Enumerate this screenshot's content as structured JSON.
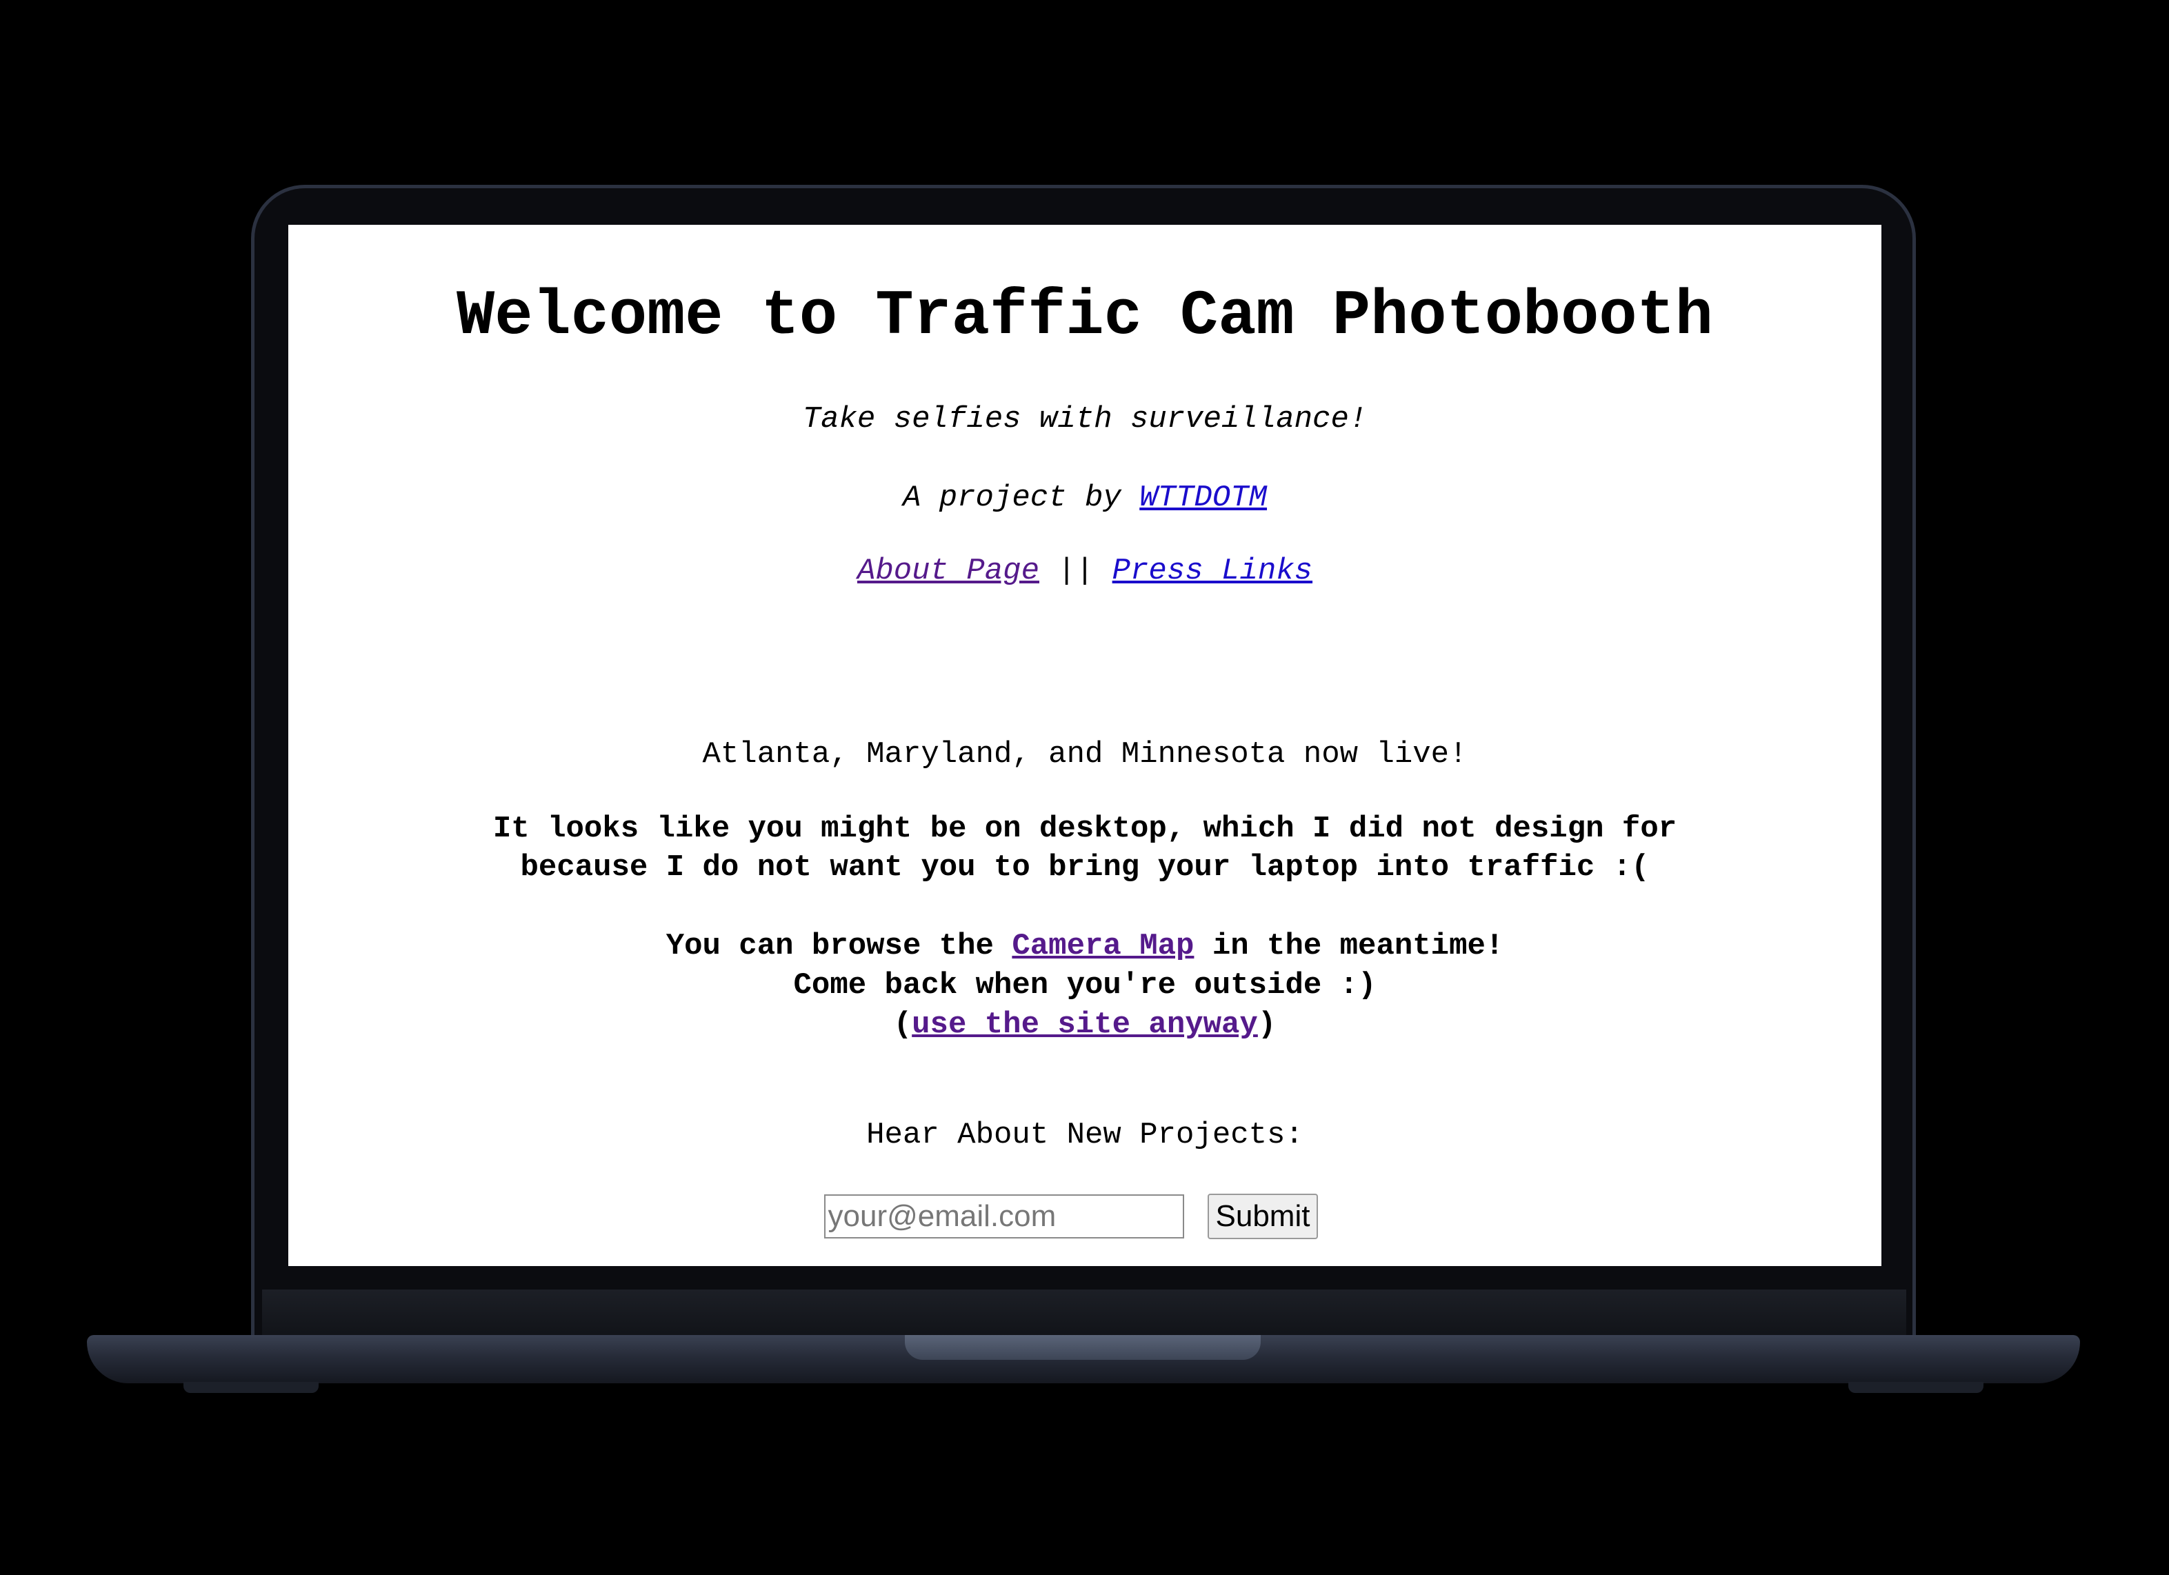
{
  "page": {
    "title": "Welcome to Traffic Cam Photobooth",
    "tagline": "Take selfies with surveillance!",
    "byline_prefix": "A project by ",
    "byline_link": "WTTDOTM",
    "nav": {
      "about_label": "About Page",
      "separator": " || ",
      "press_label": "Press Links"
    },
    "announcement": "Atlanta, Maryland, and Minnesota now live!",
    "warning_line1": "It looks like you might be on desktop, which I did not design for",
    "warning_line2": "because I do not want you to bring your laptop into traffic :(",
    "browse_prefix": "You can browse the ",
    "browse_link": "Camera Map",
    "browse_suffix": " in the meantime!",
    "come_back": "Come back when you're outside :)",
    "anyway_open": "(",
    "anyway_link": "use the site anyway",
    "anyway_close": ")",
    "newsletter_label": "Hear About New Projects:",
    "email_placeholder": "your@email.com",
    "submit_label": "Submit"
  },
  "colors": {
    "link_unvisited": "#1a0dcc",
    "link_visited": "#551a8b",
    "frame": "#000000"
  }
}
